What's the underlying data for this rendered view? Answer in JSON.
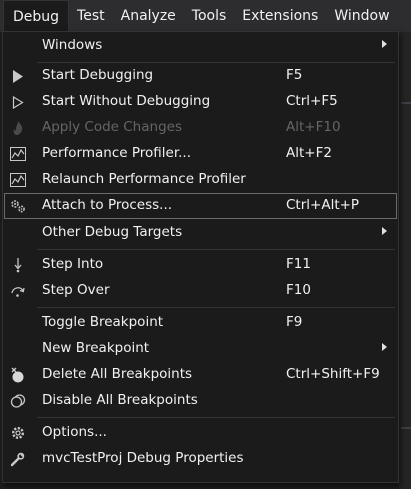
{
  "menubar": {
    "items": [
      "Debug",
      "Test",
      "Analyze",
      "Tools",
      "Extensions",
      "Window"
    ]
  },
  "menu": {
    "windows": {
      "label": "Windows"
    },
    "start_debugging": {
      "label": "Start Debugging",
      "shortcut": "F5"
    },
    "start_without_debugging": {
      "label": "Start Without Debugging",
      "shortcut": "Ctrl+F5"
    },
    "apply_code_changes": {
      "label": "Apply Code Changes",
      "shortcut": "Alt+F10"
    },
    "performance_profiler": {
      "label": "Performance Profiler...",
      "shortcut": "Alt+F2"
    },
    "relaunch_profiler": {
      "label": "Relaunch Performance Profiler"
    },
    "attach_to_process": {
      "label": "Attach to Process...",
      "shortcut": "Ctrl+Alt+P"
    },
    "other_debug_targets": {
      "label": "Other Debug Targets"
    },
    "step_into": {
      "label": "Step Into",
      "shortcut": "F11"
    },
    "step_over": {
      "label": "Step Over",
      "shortcut": "F10"
    },
    "toggle_breakpoint": {
      "label": "Toggle Breakpoint",
      "shortcut": "F9"
    },
    "new_breakpoint": {
      "label": "New Breakpoint"
    },
    "delete_all_breakpoints": {
      "label": "Delete All Breakpoints",
      "shortcut": "Ctrl+Shift+F9"
    },
    "disable_all_breakpoints": {
      "label": "Disable All Breakpoints"
    },
    "options": {
      "label": "Options..."
    },
    "project_properties": {
      "label": "mvcTestProj Debug Properties"
    }
  }
}
